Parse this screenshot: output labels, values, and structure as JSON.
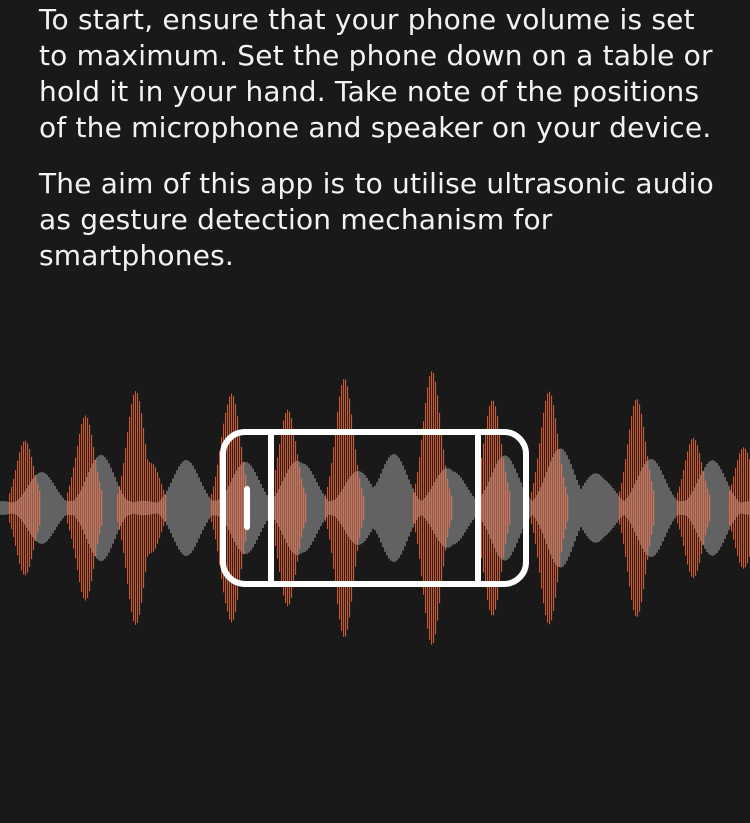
{
  "intro": {
    "paragraph_1": "To start, ensure that your phone volume is set to maximum. Set the phone down on a table or hold it in your hand. Take note of the positions of the microphone and speaker on your device.",
    "paragraph_2": "The aim of this app is to utilise ultrasonic audio as gesture detection mechanism for smartphones."
  },
  "illustration": {
    "colors": {
      "background": "#191919",
      "wave_primary": "#e8643c",
      "wave_secondary": "#d9d9d9",
      "phone_outline": "#ffffff"
    },
    "icon": "phone-on-soundwave-icon"
  }
}
